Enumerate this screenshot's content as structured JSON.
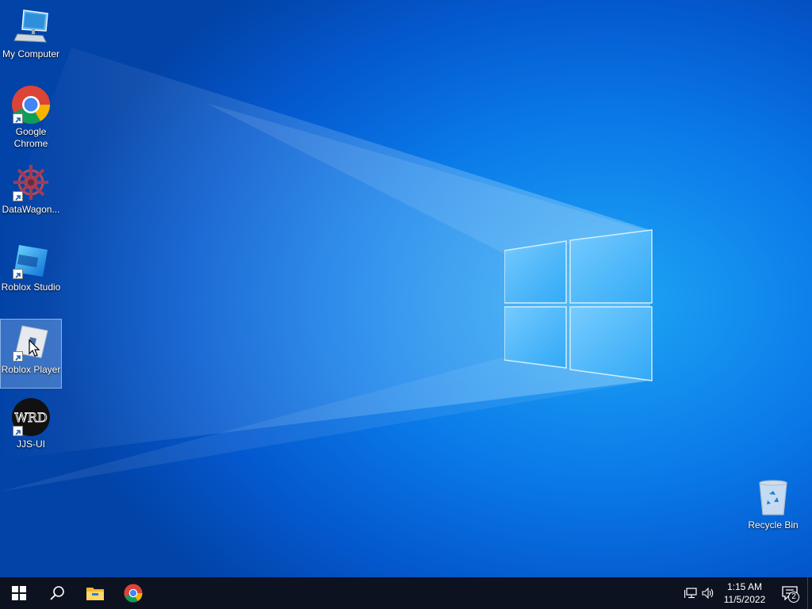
{
  "desktop": {
    "icons": [
      {
        "label": "My Computer",
        "icon": "monitor-icon"
      },
      {
        "label": "Google Chrome",
        "icon": "chrome-icon"
      },
      {
        "label": "DataWagon...",
        "icon": "datawagon-icon"
      },
      {
        "label": "Roblox Studio",
        "icon": "roblox-studio-icon"
      },
      {
        "label": "Roblox Player",
        "icon": "roblox-player-icon"
      },
      {
        "label": "JJS-UI",
        "icon": "jjs-ui-icon",
        "logo_text": "WRD"
      },
      {
        "label": "Recycle Bin",
        "icon": "recycle-bin-icon"
      }
    ]
  },
  "taskbar": {
    "pinned": [
      "start-icon",
      "search-icon",
      "file-explorer-icon",
      "chrome-icon"
    ],
    "tray": {
      "time": "1:15 AM",
      "date": "11/5/2022",
      "notification_count": "2"
    }
  },
  "colors": {
    "taskbar": "#0c1220",
    "wallpaper_accent": "#0a7ae8"
  }
}
